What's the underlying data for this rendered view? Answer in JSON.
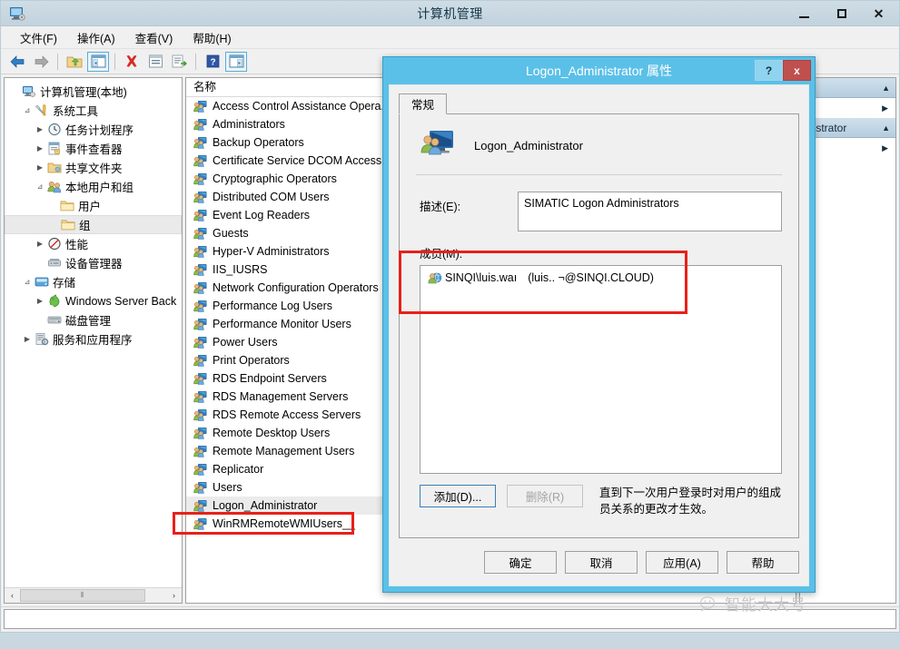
{
  "window": {
    "title": "计算机管理",
    "icon": "computer-management-icon",
    "controls": {
      "minimize": "—",
      "maximize": "□",
      "close": "✕"
    }
  },
  "menubar": [
    {
      "label": "文件(F)",
      "name": "menu-file"
    },
    {
      "label": "操作(A)",
      "name": "menu-action"
    },
    {
      "label": "查看(V)",
      "name": "menu-view"
    },
    {
      "label": "帮助(H)",
      "name": "menu-help"
    }
  ],
  "toolbar": [
    {
      "name": "back-icon",
      "glyph": "◀"
    },
    {
      "name": "forward-icon",
      "glyph": "▶"
    },
    {
      "name": "up-folder-icon",
      "glyph": "folder"
    },
    {
      "name": "show-console-tree-icon",
      "glyph": "tree"
    },
    {
      "name": "delete-icon",
      "glyph": "✕"
    },
    {
      "name": "properties-icon",
      "glyph": "props"
    },
    {
      "name": "export-list-icon",
      "glyph": "export"
    },
    {
      "name": "help-icon",
      "glyph": "?"
    },
    {
      "name": "show-action-pane-icon",
      "glyph": "pane"
    }
  ],
  "tree": {
    "nodes": [
      {
        "label": "计算机管理(本地)",
        "depth": 0,
        "twist": "",
        "icon": "computer-icon",
        "selected": false
      },
      {
        "label": "系统工具",
        "depth": 1,
        "twist": "▲",
        "icon": "tools-icon",
        "selected": false
      },
      {
        "label": "任务计划程序",
        "depth": 2,
        "twist": "▶",
        "icon": "clock-icon",
        "selected": false
      },
      {
        "label": "事件查看器",
        "depth": 2,
        "twist": "▶",
        "icon": "event-viewer-icon",
        "selected": false
      },
      {
        "label": "共享文件夹",
        "depth": 2,
        "twist": "▶",
        "icon": "shared-folder-icon",
        "selected": false
      },
      {
        "label": "本地用户和组",
        "depth": 2,
        "twist": "▲",
        "icon": "users-groups-icon",
        "selected": false
      },
      {
        "label": "用户",
        "depth": 3,
        "twist": "",
        "icon": "folder-icon",
        "selected": false
      },
      {
        "label": "组",
        "depth": 3,
        "twist": "",
        "icon": "folder-icon",
        "selected": true
      },
      {
        "label": "性能",
        "depth": 2,
        "twist": "▶",
        "icon": "performance-icon",
        "selected": false
      },
      {
        "label": "设备管理器",
        "depth": 2,
        "twist": "",
        "icon": "device-manager-icon",
        "selected": false
      },
      {
        "label": "存储",
        "depth": 1,
        "twist": "▲",
        "icon": "storage-icon",
        "selected": false
      },
      {
        "label": "Windows Server Back",
        "depth": 2,
        "twist": "▶",
        "icon": "backup-icon",
        "selected": false
      },
      {
        "label": "磁盘管理",
        "depth": 2,
        "twist": "",
        "icon": "disk-management-icon",
        "selected": false
      },
      {
        "label": "服务和应用程序",
        "depth": 1,
        "twist": "▶",
        "icon": "services-icon",
        "selected": false
      }
    ],
    "scrollbar": {
      "left_arrow": "‹",
      "right_arrow": "›",
      "grip": "⦀"
    }
  },
  "list": {
    "columns": [
      "名称",
      ""
    ],
    "rows": [
      {
        "name": "Access Control Assistance Opera...",
        "selected": false
      },
      {
        "name": "Administrators",
        "selected": false
      },
      {
        "name": "Backup Operators",
        "selected": false
      },
      {
        "name": "Certificate Service DCOM Access",
        "selected": false
      },
      {
        "name": "Cryptographic Operators",
        "selected": false
      },
      {
        "name": "Distributed COM Users",
        "selected": false
      },
      {
        "name": "Event Log Readers",
        "selected": false
      },
      {
        "name": "Guests",
        "selected": false
      },
      {
        "name": "Hyper-V Administrators",
        "selected": false
      },
      {
        "name": "IIS_IUSRS",
        "selected": false
      },
      {
        "name": "Network Configuration Operators",
        "selected": false
      },
      {
        "name": "Performance Log Users",
        "selected": false
      },
      {
        "name": "Performance Monitor Users",
        "selected": false
      },
      {
        "name": "Power Users",
        "selected": false
      },
      {
        "name": "Print Operators",
        "selected": false
      },
      {
        "name": "RDS Endpoint Servers",
        "selected": false
      },
      {
        "name": "RDS Management Servers",
        "selected": false
      },
      {
        "name": "RDS Remote Access Servers",
        "selected": false
      },
      {
        "name": "Remote Desktop Users",
        "selected": false
      },
      {
        "name": "Remote Management Users",
        "selected": false
      },
      {
        "name": "Replicator",
        "selected": false
      },
      {
        "name": "Users",
        "selected": false
      },
      {
        "name": "Logon_Administrator",
        "selected": true
      },
      {
        "name": "WinRMRemoteWMIUsers__",
        "selected": false
      }
    ]
  },
  "actions_pane": {
    "rows": [
      {
        "label": "",
        "caret": "▲",
        "header": true
      },
      {
        "label": "",
        "caret": "▶",
        "header": false
      },
      {
        "label": "nistrator",
        "caret": "▲",
        "header": true
      },
      {
        "label": "",
        "caret": "▶",
        "header": false
      }
    ]
  },
  "dialog": {
    "title": "Logon_Administrator 属性",
    "help_button": "?",
    "close_button": "x",
    "tabs": [
      {
        "label": "常规",
        "active": true
      }
    ],
    "group_icon": "group-icon",
    "group_name": "Logon_Administrator",
    "description_label": "描述(E):",
    "description_value": "SIMATIC Logon Administrators",
    "members_label": "成员(M):",
    "members": [
      {
        "icon": "domain-user-icon",
        "domain_account": "SINQI\\luis.waı",
        "upn": "(luis..      ¬@SINQI.CLOUD)"
      }
    ],
    "add_button": "添加(D)...",
    "remove_button": "删除(R)",
    "remove_disabled": true,
    "hint": "直到下一次用户登录时对用户的组成员关系的更改才生效。",
    "footer_buttons": [
      {
        "label": "确定",
        "name": "ok-button"
      },
      {
        "label": "取消",
        "name": "cancel-button"
      },
      {
        "label": "应用(A)",
        "name": "apply-button"
      },
      {
        "label": "帮助",
        "name": "help-button"
      }
    ]
  },
  "watermark": {
    "text": "智能大大号",
    "icon": "wechat-icon"
  },
  "colors": {
    "dialog_frame": "#5bc0e8",
    "annotation_red": "#e8201a",
    "titlebar": "#c9d8e0",
    "close_red": "#c0504d"
  }
}
